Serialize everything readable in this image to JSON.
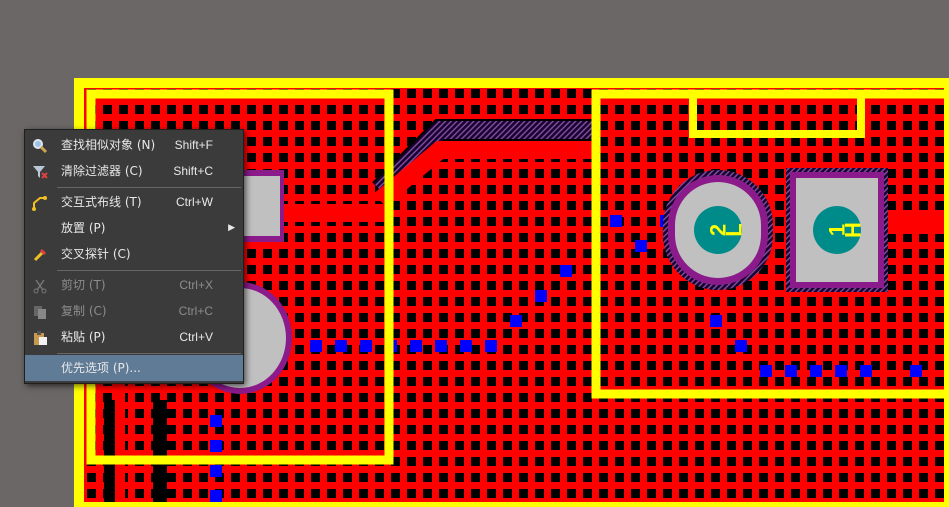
{
  "pcb": {
    "colors": {
      "background": "#6b6766",
      "silkscreen": "#ffff00",
      "top_copper": "#ff0000",
      "bottom_copper": "#0000ff",
      "board": "#000000",
      "pad": "#c0c0c0",
      "solder_mask": "#8b1a8b",
      "pad_label": "#008b8b"
    },
    "components": [
      {
        "id": "pad-2",
        "text": "2",
        "net": "L"
      },
      {
        "id": "pad-1",
        "text": "1",
        "net": "H"
      }
    ]
  },
  "context_menu": {
    "items": [
      {
        "label": "查找相似对象 (N)",
        "shortcut": "Shift+F",
        "icon": "find-similar-icon",
        "enabled": true
      },
      {
        "label": "清除过滤器 (C)",
        "shortcut": "Shift+C",
        "icon": "clear-filter-icon",
        "enabled": true
      },
      {
        "label": "交互式布线 (T)",
        "shortcut": "Ctrl+W",
        "icon": "interactive-routing-icon",
        "enabled": true
      },
      {
        "label": "放置 (P)",
        "shortcut": "",
        "icon": "",
        "enabled": true,
        "submenu": true
      },
      {
        "label": "交叉探针 (C)",
        "shortcut": "",
        "icon": "cross-probe-icon",
        "enabled": true
      },
      {
        "label": "剪切 (T)",
        "shortcut": "Ctrl+X",
        "icon": "cut-icon",
        "enabled": false
      },
      {
        "label": "复制 (C)",
        "shortcut": "Ctrl+C",
        "icon": "copy-icon",
        "enabled": false
      },
      {
        "label": "粘贴 (P)",
        "shortcut": "Ctrl+V",
        "icon": "paste-icon",
        "enabled": true
      },
      {
        "label": "优先选项 (P)...",
        "shortcut": "",
        "icon": "",
        "enabled": true,
        "highlighted": true
      }
    ],
    "submenu_arrow": "▶"
  }
}
